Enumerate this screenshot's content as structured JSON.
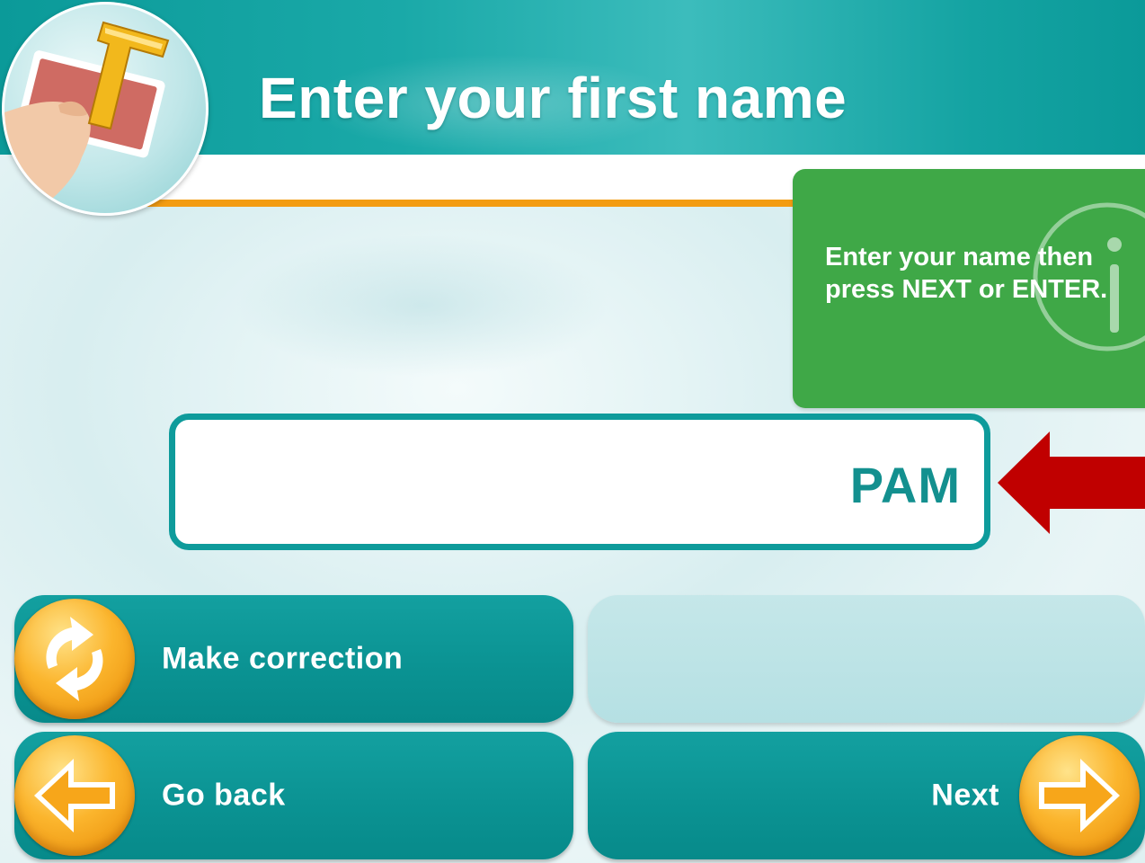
{
  "header": {
    "title": "Enter your first name"
  },
  "info_panel": {
    "message": "Enter your name then press NEXT or ENTER.",
    "icon": "info-icon"
  },
  "name_input": {
    "value": "PAM"
  },
  "buttons": {
    "make_correction": "Make correction",
    "go_back": "Go back",
    "next": "Next"
  },
  "icons": {
    "correction": "refresh-arrows-icon",
    "back": "arrow-left-icon",
    "next": "arrow-right-icon",
    "pointer": "red-arrow-pointer-icon"
  },
  "colors": {
    "accent_teal": "#0e9b9b",
    "info_green": "#3fa847",
    "orange": "#f39c12",
    "pointer_red": "#c00000"
  }
}
